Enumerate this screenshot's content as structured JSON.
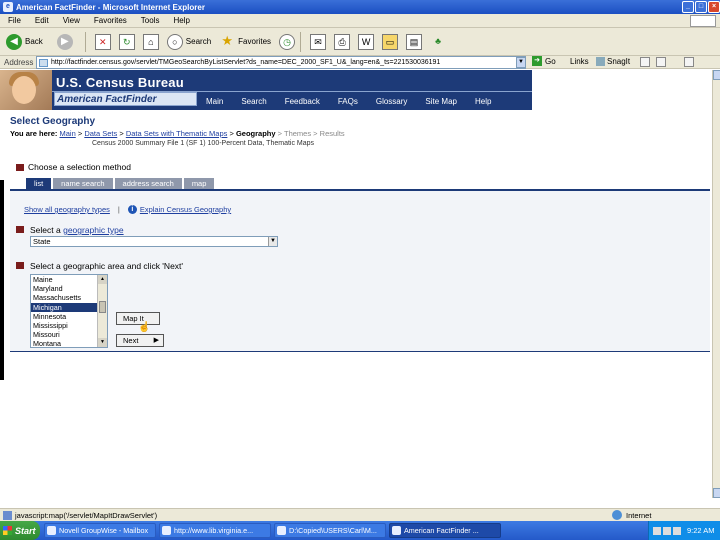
{
  "window": {
    "title": "American FactFinder - Microsoft Internet Explorer"
  },
  "menu": [
    "File",
    "Edit",
    "View",
    "Favorites",
    "Tools",
    "Help"
  ],
  "toolbar": {
    "back": "Back",
    "search": "Search",
    "favorites": "Favorites"
  },
  "address": {
    "label": "Address",
    "url": "http://factfinder.census.gov/servlet/TMGeoSearchByListServlet?ds_name=DEC_2000_SF1_U&_lang=en&_ts=221530036191",
    "go": "Go",
    "links": "Links",
    "snagit": "SnagIt"
  },
  "header": {
    "bureau": "U.S. Census Bureau",
    "product": "American FactFinder",
    "nav": [
      "Main",
      "Search",
      "Feedback",
      "FAQs",
      "Glossary",
      "Site Map",
      "Help"
    ]
  },
  "page": {
    "title": "Select Geography",
    "you_are_here": "You are here:",
    "crumbs": {
      "main": "Main",
      "data_sets": "Data Sets",
      "thematic": "Data Sets with Thematic Maps",
      "geography": "Geography",
      "themes": "Themes",
      "results": "Results"
    },
    "dataset": "Census 2000 Summary File 1 (SF 1) 100-Percent Data, Thematic Maps",
    "choose_method": "Choose a selection method",
    "tabs": [
      "list",
      "name search",
      "address search",
      "map"
    ],
    "show_all": "Show all geography types",
    "explain": "Explain Census Geography",
    "select_type_prefix": "Select a",
    "select_type_link": "geographic type",
    "selected_type": "State",
    "select_area": "Select a geographic area and click 'Next'",
    "areas": [
      "Maine",
      "Maryland",
      "Massachusetts",
      "Michigan",
      "Minnesota",
      "Mississippi",
      "Missouri",
      "Montana"
    ],
    "selected_area": "Michigan",
    "map_it": "Map It",
    "next": "Next"
  },
  "status": {
    "text": "javascript:map('/servlet/MapItDrawServlet')",
    "zone": "Internet"
  },
  "taskbar": {
    "start": "Start",
    "tasks": [
      "Novell GroupWise - Mailbox",
      "http://www.lib.virginia.e...",
      "D:\\Copied\\USERS\\Carl\\M...",
      "American FactFinder ..."
    ],
    "clock": "9:22 AM"
  }
}
